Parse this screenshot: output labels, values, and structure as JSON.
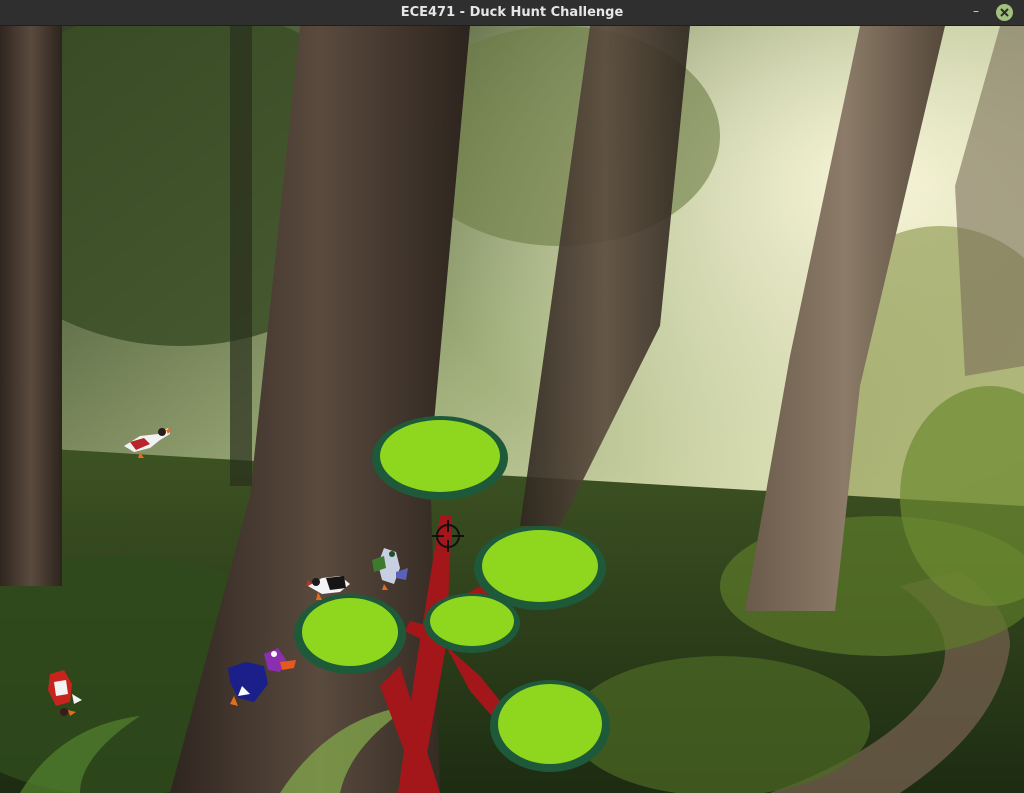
{
  "window": {
    "title": "ECE471 - Duck Hunt Challenge",
    "minimize_symbol": "–",
    "close_icon": "close-icon"
  },
  "scene": {
    "background": "redwood-forest",
    "colors": {
      "sky_light": "#d9e3b0",
      "foliage": "#3f5a22",
      "bark": "#4a3a2e",
      "path": "#6b5a48",
      "tree_leaf": "#8fd61f",
      "tree_leaf_edge": "#1e5a3a",
      "tree_trunk": "#a3171b"
    }
  },
  "ducks": [
    {
      "id": "duck-1",
      "color": "red-white",
      "state": "flying"
    },
    {
      "id": "duck-2",
      "color": "black-white",
      "state": "flying"
    },
    {
      "id": "duck-3",
      "color": "green-blue",
      "state": "falling"
    },
    {
      "id": "duck-4",
      "color": "red-white",
      "state": "falling"
    },
    {
      "id": "duck-5",
      "color": "blue-purple",
      "state": "flying"
    }
  ],
  "crosshair": {
    "icon": "crosshair-icon"
  }
}
